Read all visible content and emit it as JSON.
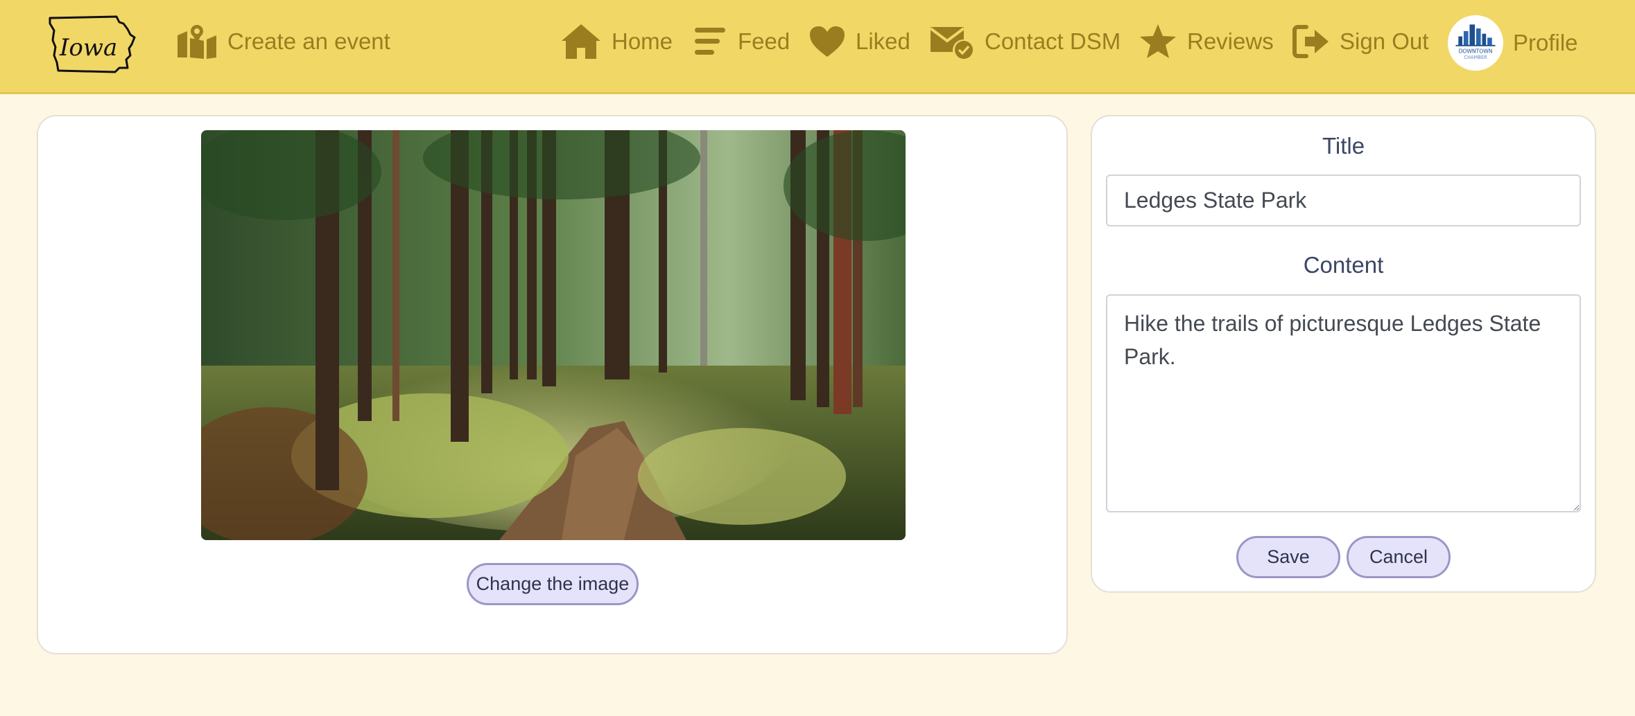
{
  "nav": {
    "brand_text": "Iowa",
    "create_event": "Create an event",
    "home": "Home",
    "feed": "Feed",
    "liked": "Liked",
    "contact": "Contact DSM",
    "reviews": "Reviews",
    "sign_out": "Sign Out",
    "profile": "Profile",
    "avatar_text_1": "DOWNTOWN",
    "avatar_text_2": "CHAMBER"
  },
  "editor": {
    "change_image": "Change the image",
    "title_label": "Title",
    "title_value": "Ledges State Park",
    "content_label": "Content",
    "content_value": "Hike the trails of picturesque Ledges State Park.",
    "save": "Save",
    "cancel": "Cancel"
  },
  "colors": {
    "navbar": "#f1d766",
    "nav_text": "#9a7d1f",
    "page_bg": "#fdf7e3",
    "button_bg": "#e5e3f9",
    "button_border": "#9a96c8"
  }
}
